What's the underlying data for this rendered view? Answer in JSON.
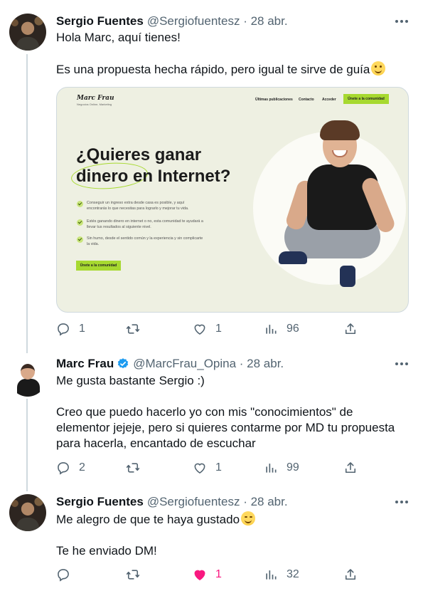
{
  "tweets": [
    {
      "name": "Sergio Fuentes",
      "handle": "@Sergiofuentesz · 28 abr.",
      "lines": [
        "Hola Marc, aquí tienes!",
        "Es una propuesta hecha rápido, pero igual te sirve de guía"
      ],
      "actions": {
        "replies": "1",
        "retweets": "",
        "likes": "1",
        "views": "96"
      },
      "liked": false
    },
    {
      "name": "Marc Frau",
      "handle": "@MarcFrau_Opina · 28 abr.",
      "verified": true,
      "lines": [
        "Me gusta bastante Sergio :)",
        "Creo que puedo hacerlo yo con mis \"conocimientos\" de",
        "elementor jejeje, pero si quieres contarme por MD tu propuesta",
        "para hacerla, encantado de escuchar"
      ],
      "actions": {
        "replies": "2",
        "retweets": "",
        "likes": "1",
        "views": "99"
      },
      "liked": false
    },
    {
      "name": "Sergio Fuentes",
      "handle": "@Sergiofuentesz · 28 abr.",
      "lines": [
        "Me alegro de que te haya gustado",
        "Te he enviado DM!"
      ],
      "actions": {
        "replies": "",
        "retweets": "",
        "likes": "1",
        "views": "32"
      },
      "liked": true
    }
  ],
  "card": {
    "logo": "Marc Frau",
    "logo_sub": "Negocios Online, Marketing",
    "nav": [
      "Últimas publicaciones",
      "Contacto",
      "Acceder"
    ],
    "nav_button": "Únete a la comunidad",
    "headline_1": "¿Quieres ganar",
    "headline_2": "dinero en Internet?",
    "bullets": [
      "Conseguir un ingreso extra desde casa es posible, y aquí encontrarás lo que necesitas para lograrlo y mejorar tu vida.",
      "Estés ganando dinero en internet o no, esta comunidad te ayudará a llevar tus resultados al siguiente nivel.",
      "Sin humo, desde el sentido común y la experiencia y sin complicarte la vida."
    ],
    "cta": "Únete a la comunidad"
  },
  "colors": {
    "text": "#0f1419",
    "secondary": "#536471",
    "verified": "#1d9bf0",
    "like_active": "#f91880",
    "accent_green": "#a7d930",
    "card_bg": "#eef0e2"
  },
  "icons": [
    "more-icon",
    "reply-icon",
    "retweet-icon",
    "like-icon",
    "views-icon",
    "share-icon",
    "verified-badge-icon"
  ]
}
